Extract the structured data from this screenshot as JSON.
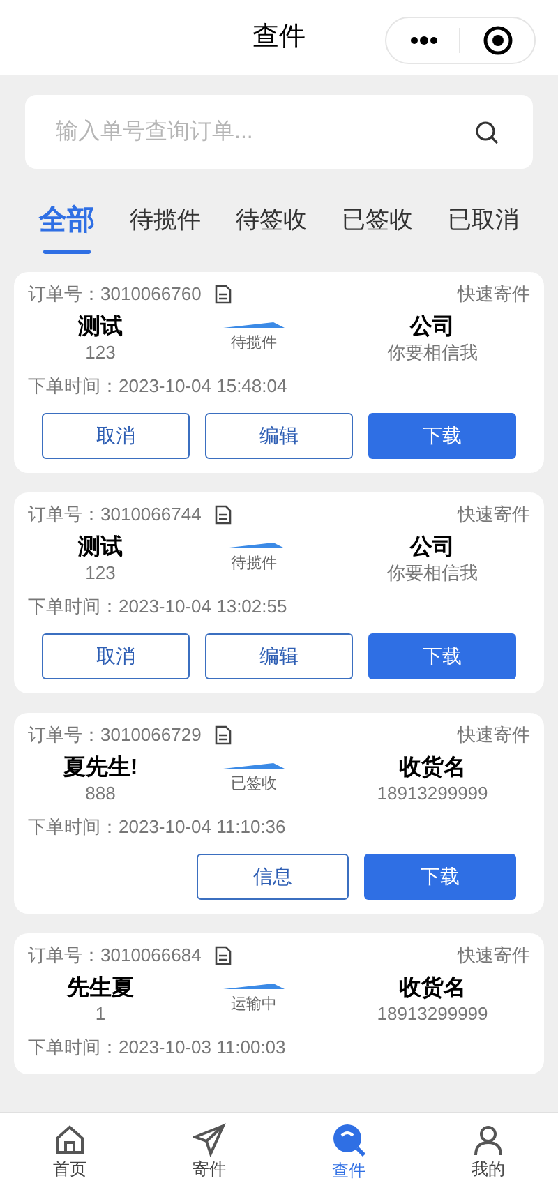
{
  "header": {
    "title": "查件"
  },
  "search": {
    "placeholder": "输入单号查询订单..."
  },
  "tabs": [
    {
      "label": "全部",
      "selected": true
    },
    {
      "label": "待揽件",
      "selected": false
    },
    {
      "label": "待签收",
      "selected": false
    },
    {
      "label": "已签收",
      "selected": false
    },
    {
      "label": "已取消",
      "selected": false
    }
  ],
  "orders": [
    {
      "order_label": "订单号：",
      "order_no": "3010066760",
      "type": "快速寄件",
      "sender": {
        "name": "测试",
        "detail": "123"
      },
      "status": "待揽件",
      "receiver": {
        "name": "公司",
        "detail": "你要相信我"
      },
      "time_label": "下单时间：",
      "time": "2023-10-04 15:48:04",
      "buttons": [
        {
          "label": "取消",
          "kind": "outline"
        },
        {
          "label": "编辑",
          "kind": "outline"
        },
        {
          "label": "下载",
          "kind": "primary"
        }
      ]
    },
    {
      "order_label": "订单号：",
      "order_no": "3010066744",
      "type": "快速寄件",
      "sender": {
        "name": "测试",
        "detail": "123"
      },
      "status": "待揽件",
      "receiver": {
        "name": "公司",
        "detail": "你要相信我"
      },
      "time_label": "下单时间：",
      "time": "2023-10-04 13:02:55",
      "buttons": [
        {
          "label": "取消",
          "kind": "outline"
        },
        {
          "label": "编辑",
          "kind": "outline"
        },
        {
          "label": "下载",
          "kind": "primary"
        }
      ]
    },
    {
      "order_label": "订单号：",
      "order_no": "3010066729",
      "type": "快速寄件",
      "sender": {
        "name": "夏先生!",
        "detail": "888"
      },
      "status": "已签收",
      "receiver": {
        "name": "收货名",
        "detail": "18913299999"
      },
      "time_label": "下单时间：",
      "time": "2023-10-04 11:10:36",
      "buttons": [
        {
          "label": "信息",
          "kind": "outline"
        },
        {
          "label": "下载",
          "kind": "primary"
        }
      ]
    },
    {
      "order_label": "订单号：",
      "order_no": "3010066684",
      "type": "快速寄件",
      "sender": {
        "name": "先生夏",
        "detail": "1"
      },
      "status": "运输中",
      "receiver": {
        "name": "收货名",
        "detail": "18913299999"
      },
      "time_label": "下单时间：",
      "time": "2023-10-03 11:00:03"
    }
  ],
  "nav": [
    {
      "label": "首页",
      "kind": "home",
      "selected": false
    },
    {
      "label": "寄件",
      "kind": "send",
      "selected": false
    },
    {
      "label": "查件",
      "kind": "search",
      "selected": true
    },
    {
      "label": "我的",
      "kind": "user",
      "selected": false
    }
  ]
}
